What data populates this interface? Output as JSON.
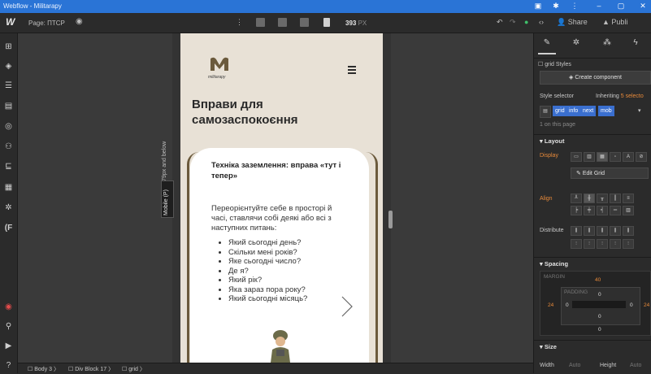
{
  "titlebar": {
    "title": "Webflow - Militarapy",
    "window_controls": [
      "minimize",
      "maximize",
      "close"
    ]
  },
  "toolbar": {
    "logo": "W",
    "page_label": "Page: ПТСР",
    "width_value": "393",
    "width_unit": "PX",
    "share_label": "Share",
    "publish_label": "Publi"
  },
  "mobile_page": {
    "logo_text": "militarapy",
    "heading": "Вправи для самозаспокоєння",
    "card_title": "Техніка заземлення: вправа «тут і тепер»",
    "card_text": "Переорієнтуйте себе в просторі й часі, ставлячи собі деякі або всі з наступних питань:",
    "questions": [
      "Який сьогодні день?",
      "Скільки мені років?",
      "Яке сьогодні число?",
      "Де я?",
      "Який рік?",
      "Яка зараз пора року?",
      "Який сьогодні місяць?"
    ]
  },
  "canvas": {
    "affects_label": "Affects 479px and below",
    "mobile_tag": "Mobile (P)"
  },
  "breadcrumb": [
    "Body 3",
    "Div Block 17",
    "grid"
  ],
  "panel": {
    "grid_styles": "grid Styles",
    "create_component": "Create component",
    "style_selector": "Style selector",
    "inheriting": "Inheriting",
    "inheriting_count": "5 selecto",
    "chips": [
      "grid",
      "info",
      "next",
      "mob"
    ],
    "on_page": "1 on this page",
    "layout_label": "Layout",
    "display_label": "Display",
    "edit_grid": "Edit Grid",
    "align_label": "Align",
    "distribute_label": "Distribute",
    "spacing_label": "Spacing",
    "margin_label": "MARGIN",
    "padding_label": "PADDING",
    "margin_top": "40",
    "margin_left": "24",
    "margin_right": "24",
    "pad_top": "0",
    "pad_left": "0",
    "pad_right": "0",
    "pad_bottom": "0",
    "margin_bottom": "0",
    "size_label": "Size",
    "width_label": "Width",
    "width_val": "Auto",
    "height_label": "Height",
    "height_val": "Auto"
  },
  "colors": {
    "accent": "#2a74d6",
    "orange": "#e88a3a",
    "chip": "#3a6fcf"
  }
}
